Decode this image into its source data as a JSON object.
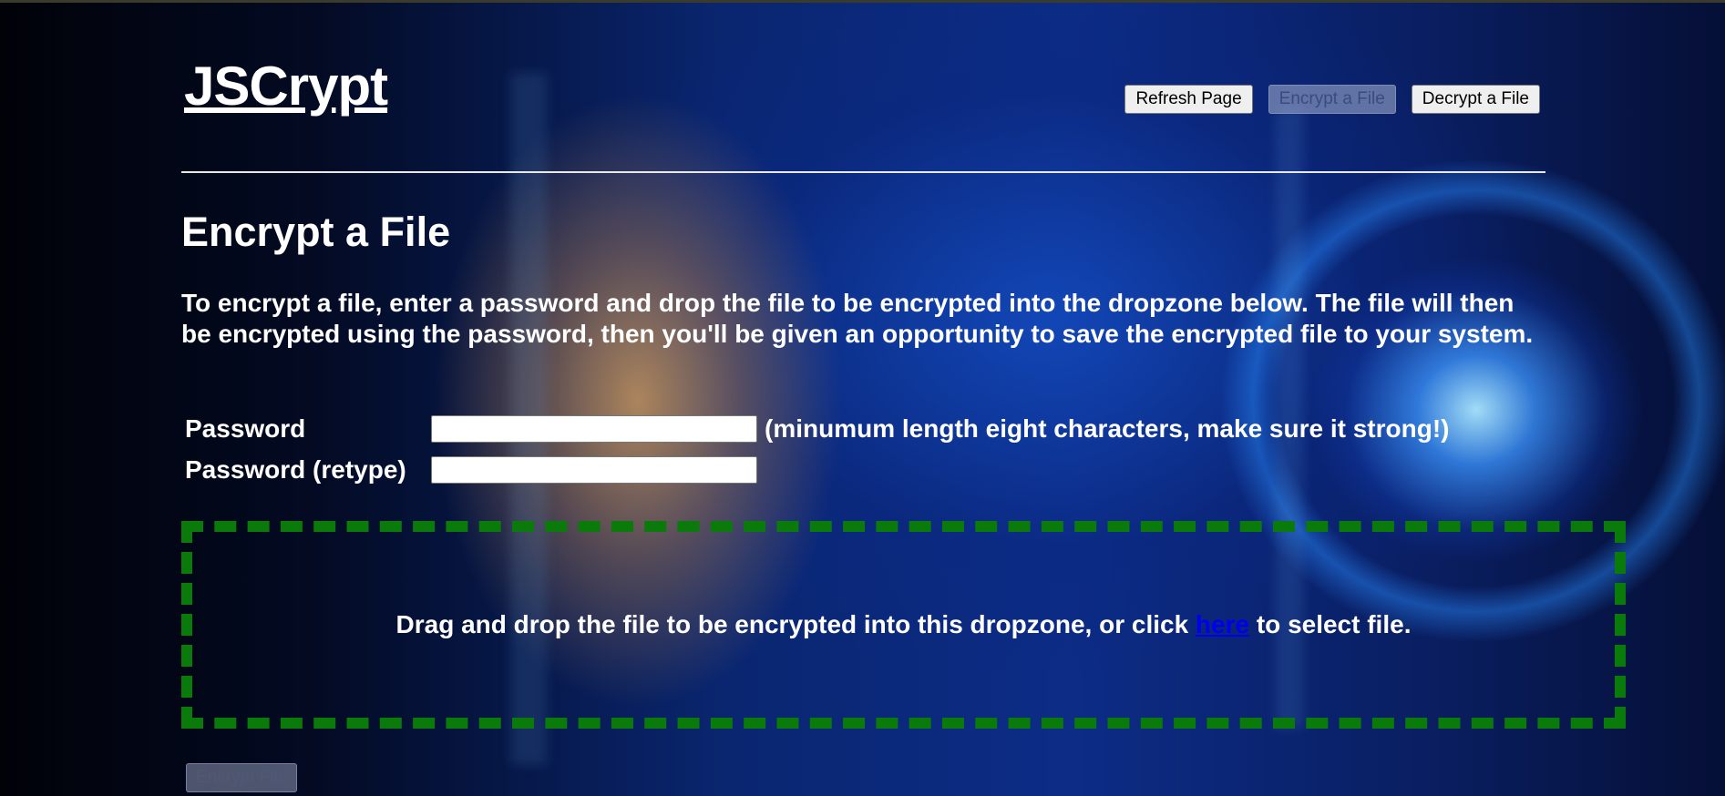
{
  "app": {
    "title": "JSCrypt"
  },
  "nav": {
    "refresh_label": "Refresh Page",
    "encrypt_label": "Encrypt a File",
    "decrypt_label": "Decrypt a File",
    "encrypt_disabled": true
  },
  "section": {
    "heading": "Encrypt a File",
    "instructions": "To encrypt a file, enter a password and drop the file to be encrypted into the dropzone below. The file will then be encrypted using the password, then you'll be given an opportunity to save the encrypted file to your system."
  },
  "form": {
    "password_label": "Password",
    "password_value": "",
    "password_hint": "(minumum length eight characters, make sure it strong!)",
    "retype_label": "Password (retype)",
    "retype_value": ""
  },
  "dropzone": {
    "text_before": "Drag and drop the file to be encrypted into this dropzone, or click ",
    "link_text": "here",
    "text_after": " to select file.",
    "border_color": "#0a7a0a"
  },
  "actions": {
    "encrypt_file_label": "Encrypt File",
    "encrypt_file_disabled": true
  },
  "colors": {
    "text": "#ffffff",
    "link": "#0000ee",
    "dropzone_border": "#0a7a0a"
  }
}
